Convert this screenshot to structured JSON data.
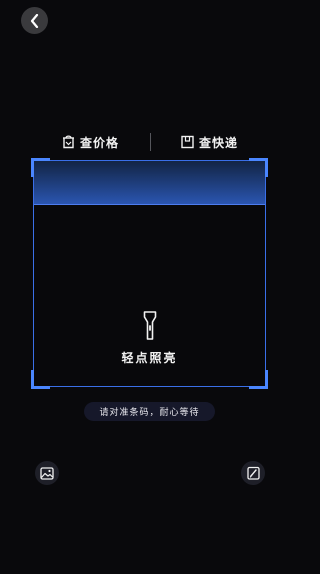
{
  "header": {
    "back_icon": "chevron-left-icon"
  },
  "tabs": [
    {
      "label": "查价格",
      "icon": "price-tag-icon"
    },
    {
      "label": "查快递",
      "icon": "package-icon"
    }
  ],
  "scanner": {
    "flashlight_icon": "flashlight-icon",
    "flashlight_label": "轻点照亮"
  },
  "hint": "请对准条码，耐心等待",
  "bottom_actions": [
    {
      "name": "album",
      "icon": "image-icon"
    },
    {
      "name": "manual-input",
      "icon": "edit-icon"
    }
  ],
  "colors": {
    "background": "#09090c",
    "accent": "#4a86ff",
    "frame_border": "#3a6fe8"
  }
}
